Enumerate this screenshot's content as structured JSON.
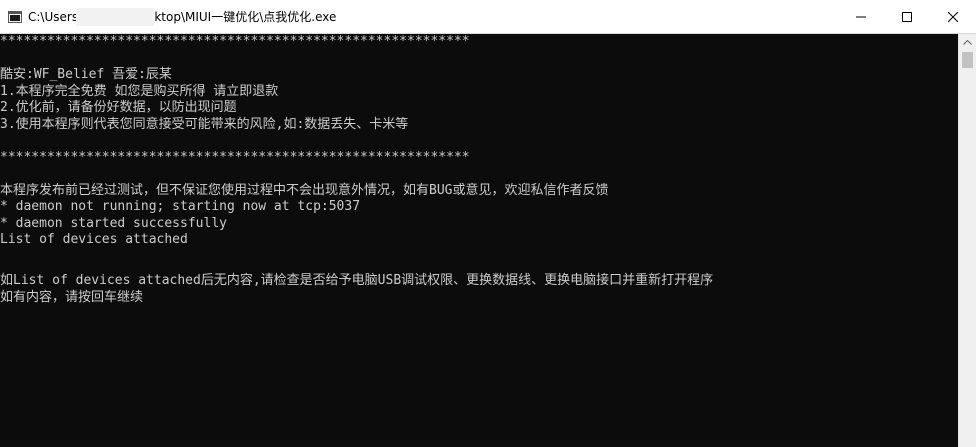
{
  "window": {
    "title": "C:\\Users              Desktop\\MIUI一键优化\\点我优化.exe"
  },
  "icons": {
    "app": "console-app-icon",
    "minimize": "minimize-icon",
    "maximize": "maximize-icon",
    "close": "close-icon",
    "scroll_up": "scroll-up-arrow-icon"
  },
  "console": {
    "lines": [
      "************************************************************",
      "",
      "酷安:WF_Belief 吾爱:辰某",
      "1.本程序完全免费 如您是购买所得 请立即退款",
      "2.优化前，请备份好数据，以防出现问题",
      "3.使用本程序则代表您同意接受可能带来的风险,如:数据丢失、卡米等",
      "",
      "************************************************************",
      "",
      "本程序发布前已经过测试，但不保证您使用过程中不会出现意外情况，如有BUG或意见，欢迎私信作者反馈",
      "* daemon not running; starting now at tcp:5037",
      "* daemon started successfully",
      "List of devices attached",
      "",
      "",
      "如List of devices attached后无内容,请检查是否给予电脑USB调试权限、更换数据线、更换电脑接口并重新打开程序",
      "如有内容，请按回车继续"
    ]
  },
  "colors": {
    "console_bg": "#0c0c0c",
    "console_text": "#cccccc",
    "titlebar_bg": "#ffffff"
  }
}
